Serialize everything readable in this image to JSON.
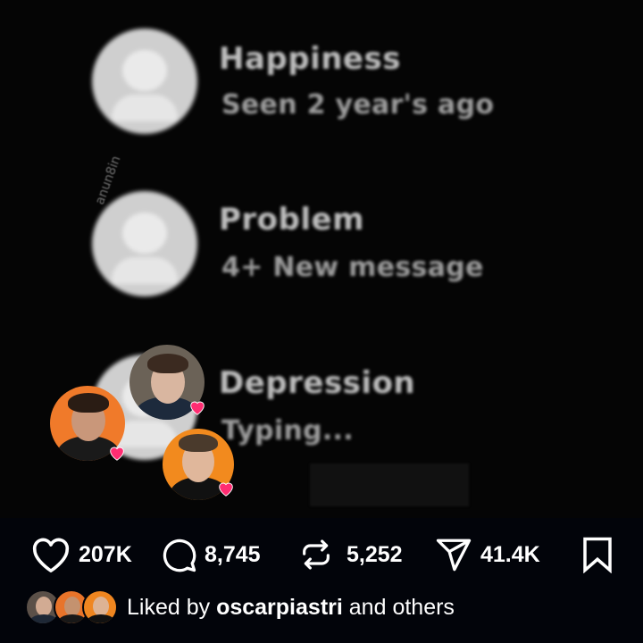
{
  "post": {
    "chats": [
      {
        "name": "Happiness",
        "status": "Seen 2 year's ago"
      },
      {
        "name": "Problem",
        "status": "4+ New message"
      },
      {
        "name": "Depression",
        "status": "Typing..."
      }
    ],
    "watermark": "anun8in"
  },
  "actions": {
    "likes": "207K",
    "comments": "8,745",
    "reposts": "5,252",
    "shares": "41.4K"
  },
  "liked_by": {
    "prefix": "Liked by",
    "user": "oscarpiastri",
    "suffix": "and others"
  },
  "colors": {
    "background": "#000000",
    "heart": "#ff2d72",
    "avatar_ring": "#ff8a1f"
  },
  "icons": [
    "heart-icon",
    "comment-icon",
    "repost-icon",
    "share-icon",
    "bookmark-icon"
  ]
}
